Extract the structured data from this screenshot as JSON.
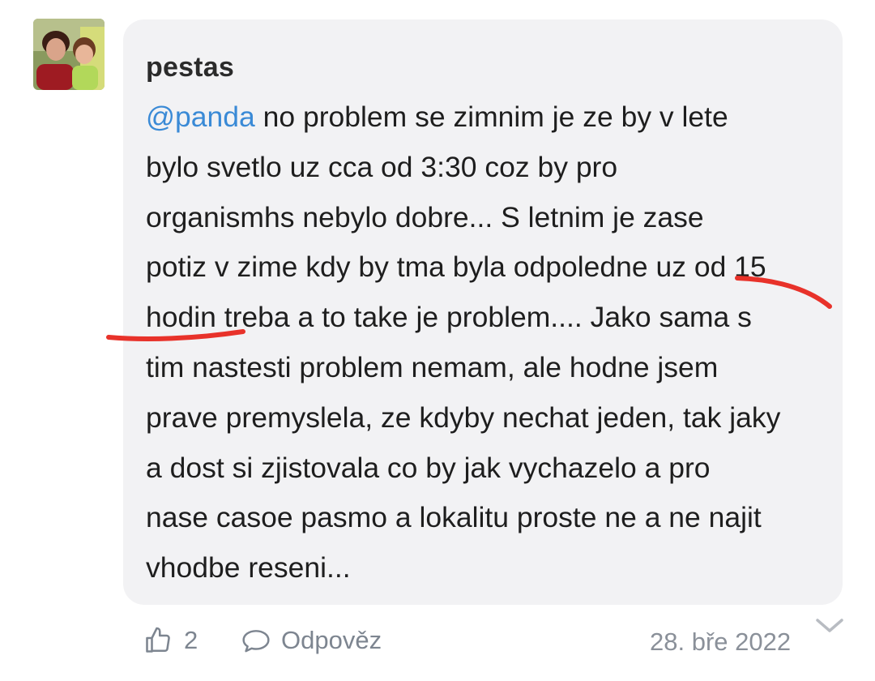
{
  "comment": {
    "username": "pestas",
    "mention": "@panda",
    "text_lines": [
      " no problem se zimnim je ze by v lete",
      "bylo svetlo uz cca od 3:30 coz by pro",
      "organismhs nebylo dobre... S letnim je zase",
      "potiz v zime kdy by tma byla odpoledne uz od 15",
      "hodin treba a to take je problem.... Jako sama s",
      "tim nastesti problem nemam, ale hodne jsem",
      "prave premyslela, ze kdyby nechat jeden, tak jaky",
      "a dost si zjistovala co by jak vychazelo a pro",
      "nase casoe pasmo a lokalitu proste ne a ne najit",
      "vhodbe reseni..."
    ]
  },
  "footer": {
    "like_count": "2",
    "reply_label": "Odpověz",
    "date": "28. bře 2022"
  },
  "icons": {
    "like": "thumbs-up-icon",
    "reply": "speech-bubble-icon",
    "expand": "chevron-down-icon"
  },
  "colors": {
    "mention": "#3a8ad6",
    "bubble_bg": "#f2f2f4",
    "annotation": "#e8322a",
    "meta_text": "#7d8590"
  }
}
